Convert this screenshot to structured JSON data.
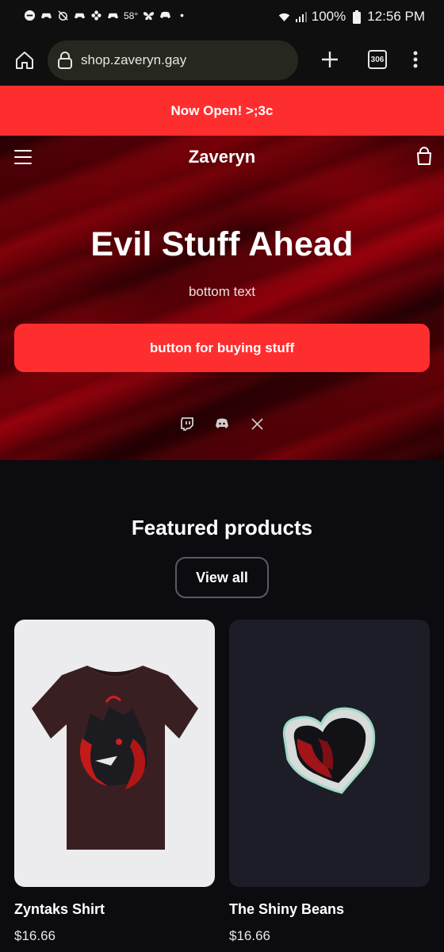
{
  "status_bar": {
    "temperature": "58°",
    "battery": "100%",
    "time": "12:56 PM",
    "icons": [
      "dnd-icon",
      "game-icon",
      "alarm-off-icon",
      "game-icon",
      "flower-icon",
      "game-icon",
      "butterfly-icon",
      "discord-icon",
      "dot-icon",
      "wifi-icon",
      "signal-icon",
      "battery-icon"
    ]
  },
  "browser": {
    "url": "shop.zaveryn.gay",
    "tab_count": "306"
  },
  "announcement": "Now Open! >;3c",
  "header": {
    "brand": "Zaveryn"
  },
  "hero": {
    "title": "Evil Stuff Ahead",
    "subtitle": "bottom text",
    "button": "button for buying stuff",
    "socials": [
      "twitch-icon",
      "discord-icon",
      "x-icon"
    ]
  },
  "featured": {
    "title": "Featured products",
    "view_all": "View all",
    "products": [
      {
        "name": "Zyntaks Shirt",
        "price": "$16.66"
      },
      {
        "name": "The Shiny Beans",
        "price": "$16.66"
      }
    ]
  },
  "colors": {
    "accent": "#ff2e2e",
    "background": "#0b0b10",
    "card_dark": "#1c1d26"
  }
}
